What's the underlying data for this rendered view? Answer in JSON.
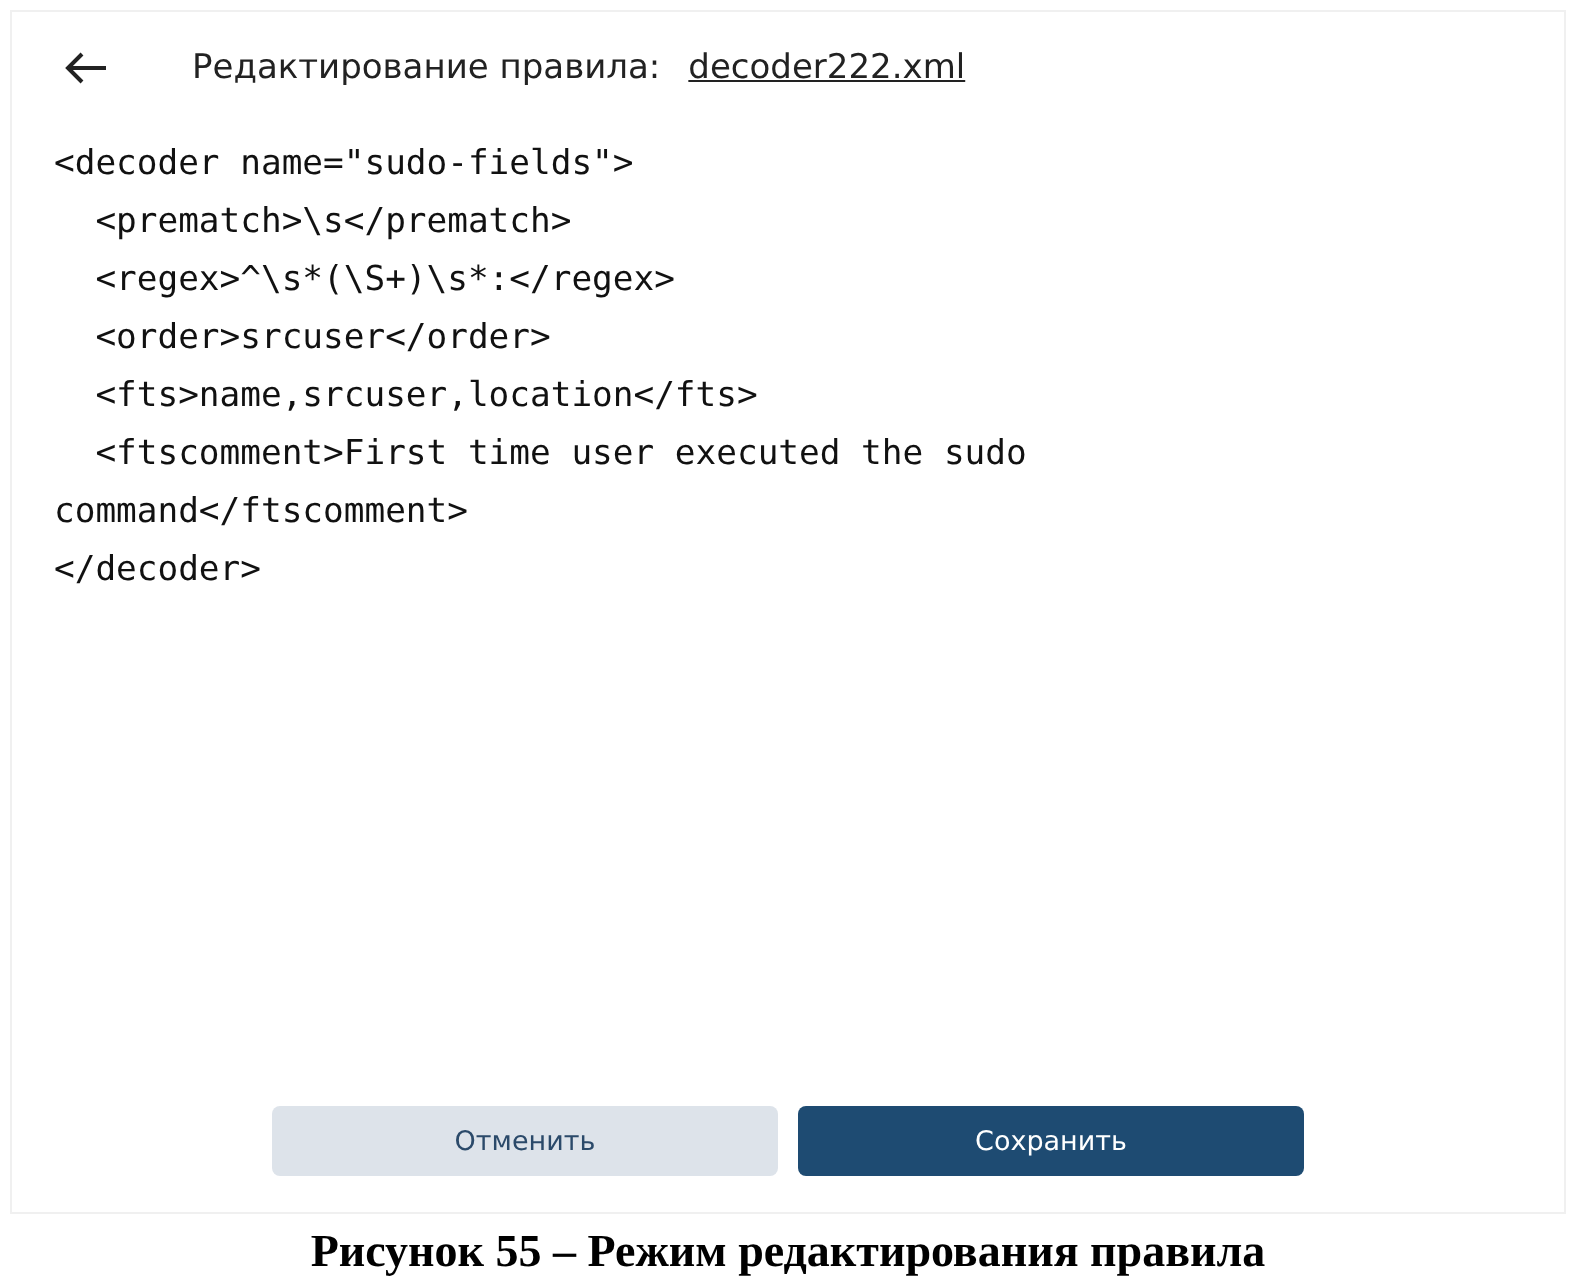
{
  "header": {
    "title": "Редактирование правила:",
    "file_link": "decoder222.xml"
  },
  "editor": {
    "lines": [
      "<decoder name=\"sudo-fields\">",
      "  <prematch>\\s</prematch>",
      "  <regex>^\\s*(\\S+)\\s*:</regex>",
      "  <order>srcuser</order>",
      "  <fts>name,srcuser,location</fts>",
      "  <ftscomment>First time user executed the sudo",
      "command</ftscomment>",
      "</decoder>"
    ]
  },
  "buttons": [
    {
      "label": "Отменить",
      "kind": "secondary"
    },
    {
      "label": "Сохранить",
      "kind": "primary"
    }
  ],
  "caption": "Рисунок 55 – Режим редактирования правила"
}
